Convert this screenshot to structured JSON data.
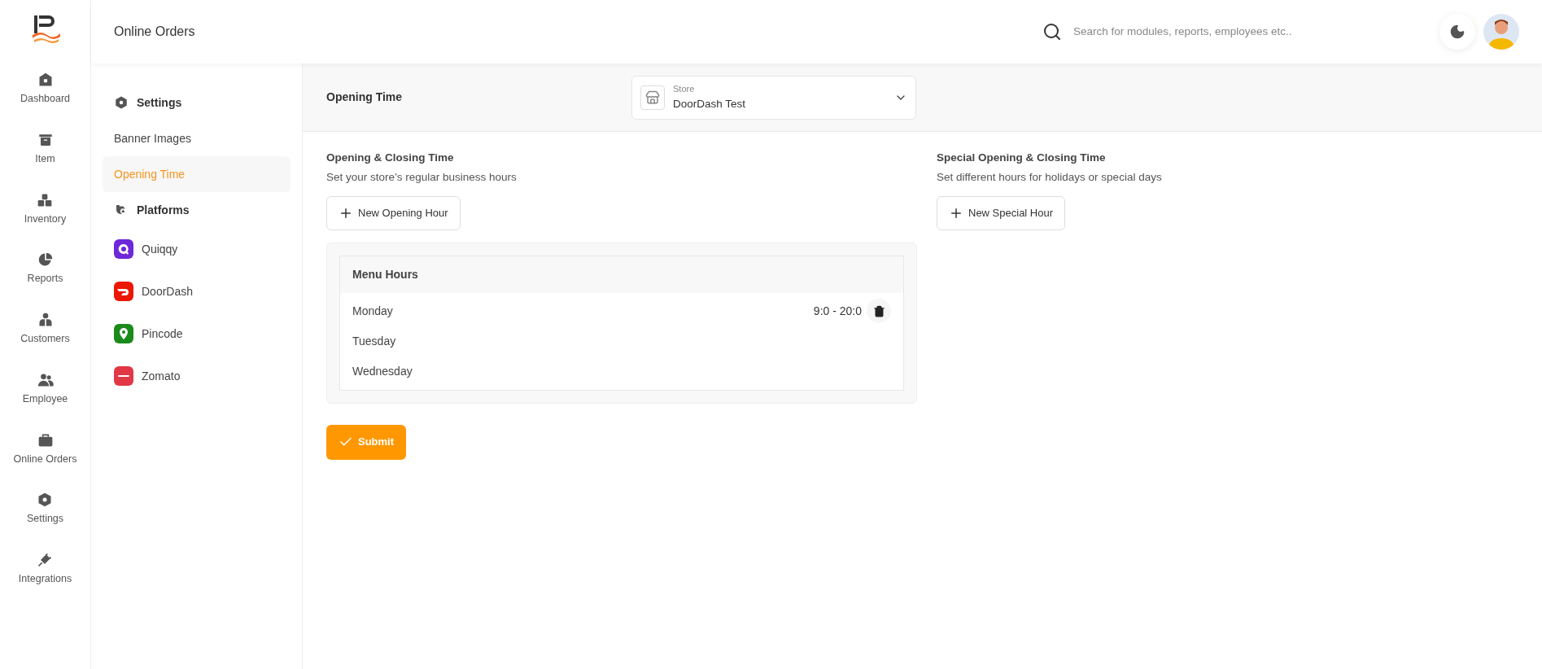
{
  "nav": [
    {
      "label": "Dashboard"
    },
    {
      "label": "Item"
    },
    {
      "label": "Inventory"
    },
    {
      "label": "Reports"
    },
    {
      "label": "Customers"
    },
    {
      "label": "Employee"
    },
    {
      "label": "Online Orders"
    },
    {
      "label": "Settings"
    },
    {
      "label": "Integrations"
    }
  ],
  "header": {
    "title": "Online Orders",
    "search": {
      "placeholder": "Search for modules, reports, employees etc.."
    }
  },
  "settings_menu": [
    {
      "heading": "Settings",
      "items": [
        {
          "label": "Banner Images",
          "selected": false
        },
        {
          "label": "Opening Time",
          "selected": true
        }
      ]
    },
    {
      "heading": "Platforms",
      "items": [
        {
          "label": "Quiqqy",
          "selected": false,
          "color": "#6d28d9"
        },
        {
          "label": "DoorDash",
          "selected": false,
          "color": "#eb1700"
        },
        {
          "label": "Pincode",
          "selected": false,
          "color": "#1a8a1a"
        },
        {
          "label": "Zomato",
          "selected": false,
          "color": "#e23744"
        }
      ]
    }
  ],
  "page": {
    "title": "Opening Time",
    "store": {
      "label": "Store",
      "value": "DoorDash Test"
    }
  },
  "regular": {
    "title": "Opening & Closing Time",
    "subtitle": "Set your store’s regular business hours",
    "button": "New Opening Hour",
    "table": {
      "heading": "Menu Hours",
      "rows": [
        {
          "day": "Monday",
          "hours": "9:0 - 20:0"
        },
        {
          "day": "Tuesday"
        },
        {
          "day": "Wednesday"
        }
      ]
    }
  },
  "special": {
    "title": "Special Opening & Closing Time",
    "subtitle": "Set different hours for holidays or special days",
    "button": "New Special Hour"
  },
  "submit": "Submit"
}
